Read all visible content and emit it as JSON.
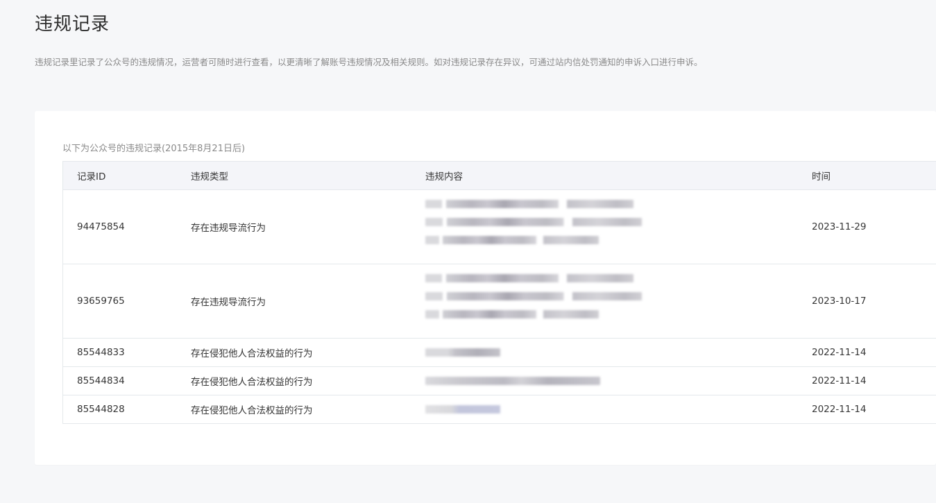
{
  "page": {
    "title": "违规记录",
    "description": "违规记录里记录了公众号的违规情况，运营者可随时进行查看，以更清晰了解账号违规情况及相关规则。如对违规记录存在异议，可通过站内信处罚通知的申诉入口进行申诉。"
  },
  "table": {
    "caption": "以下为公众号的违规记录(2015年8月21日后)",
    "headers": {
      "id": "记录ID",
      "type": "违规类型",
      "content": "违规内容",
      "time": "时间"
    },
    "rows": [
      {
        "id": "94475854",
        "type": "存在违规导流行为",
        "time": "2023-11-29"
      },
      {
        "id": "93659765",
        "type": "存在违规导流行为",
        "time": "2023-10-17"
      },
      {
        "id": "85544833",
        "type": "存在侵犯他人合法权益的行为",
        "time": "2022-11-14"
      },
      {
        "id": "85544834",
        "type": "存在侵犯他人合法权益的行为",
        "time": "2022-11-14"
      },
      {
        "id": "85544828",
        "type": "存在侵犯他人合法权益的行为",
        "time": "2022-11-14"
      }
    ]
  }
}
